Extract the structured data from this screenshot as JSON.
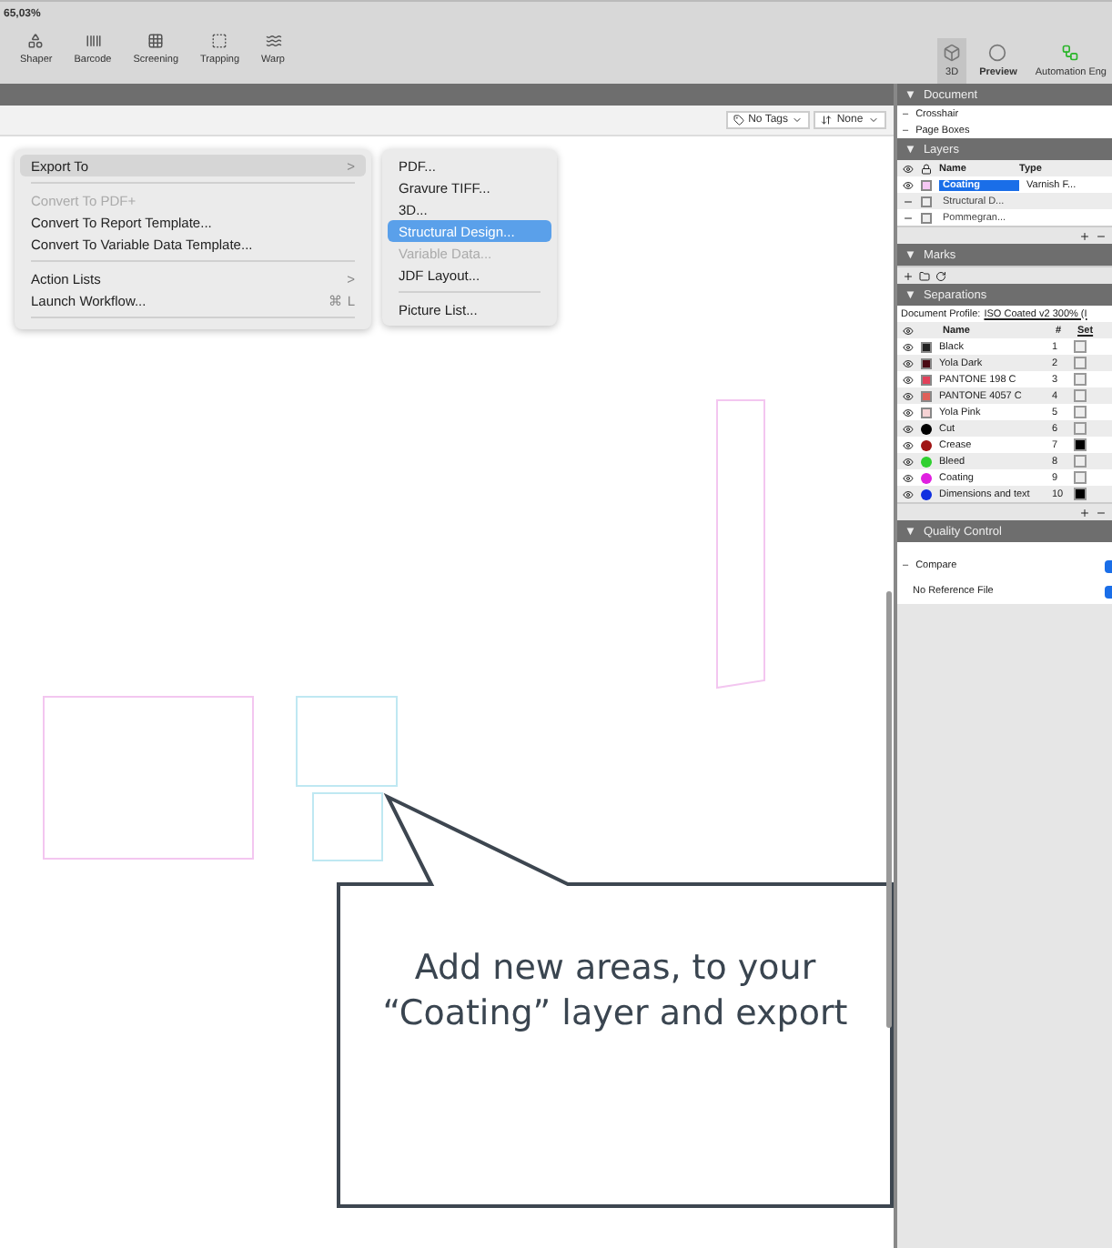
{
  "zoom": "65,03%",
  "tools": [
    {
      "label": "Shaper",
      "kind": "shaper"
    },
    {
      "label": "Barcode",
      "kind": "barcode"
    },
    {
      "label": "Screening",
      "kind": "screening"
    },
    {
      "label": "Trapping",
      "kind": "trapping"
    },
    {
      "label": "Warp",
      "kind": "warp"
    }
  ],
  "view_tools": [
    {
      "label": "3D",
      "kind": "cube",
      "selected": true
    },
    {
      "label": "Preview",
      "kind": "preview",
      "selected": false
    },
    {
      "label": "Automation Eng",
      "kind": "automation",
      "selected": false
    }
  ],
  "filters": [
    {
      "label": "No Tags",
      "kind": "tag"
    },
    {
      "label": "None",
      "kind": "sort"
    }
  ],
  "menu": {
    "items": [
      {
        "kind": "item",
        "label": "Export To",
        "arrow": ">",
        "selected": true,
        "disabled": false
      },
      {
        "kind": "separator"
      },
      {
        "kind": "item",
        "label": "Convert To PDF+",
        "selected": false,
        "disabled": true
      },
      {
        "kind": "item",
        "label": "Convert To Report Template...",
        "selected": false,
        "disabled": false
      },
      {
        "kind": "item",
        "label": "Convert To Variable Data Template...",
        "selected": false,
        "disabled": false
      },
      {
        "kind": "separator"
      },
      {
        "kind": "item",
        "label": "Action Lists",
        "arrow": ">",
        "selected": false,
        "disabled": false
      },
      {
        "kind": "item",
        "label": "Launch Workflow...",
        "shortcut": "⌘ L",
        "selected": false,
        "disabled": false
      },
      {
        "kind": "separator"
      }
    ]
  },
  "submenu": {
    "items": [
      {
        "kind": "item",
        "label": "PDF...",
        "selected": false,
        "disabled": false
      },
      {
        "kind": "item",
        "label": "Gravure TIFF...",
        "selected": false,
        "disabled": false
      },
      {
        "kind": "item",
        "label": "3D...",
        "selected": false,
        "disabled": false
      },
      {
        "kind": "item",
        "label": "Structural Design...",
        "selected": true,
        "disabled": false
      },
      {
        "kind": "item",
        "label": "Variable Data...",
        "selected": false,
        "disabled": true
      },
      {
        "kind": "item",
        "label": "JDF Layout...",
        "selected": false,
        "disabled": false
      },
      {
        "kind": "separator"
      },
      {
        "kind": "item",
        "label": "Picture List...",
        "selected": false,
        "disabled": false
      }
    ]
  },
  "document": {
    "marker": "▼",
    "title": "Document",
    "items": [
      {
        "marker": "–",
        "label": "Crosshair"
      },
      {
        "marker": "–",
        "label": "Page Boxes"
      }
    ]
  },
  "layers": {
    "marker": "▼",
    "title": "Layers",
    "columns": [
      "Name",
      "Type"
    ],
    "rows": [
      {
        "visible": true,
        "name": "Coating",
        "type": "Varnish F...",
        "selected": true
      },
      {
        "visible": false,
        "name": "Structural D...",
        "selected": false
      },
      {
        "visible": false,
        "name": "Pommegran...",
        "selected": false
      }
    ]
  },
  "marks": {
    "marker": "▼",
    "title": "Marks"
  },
  "separations": {
    "marker": "▼",
    "title": "Separations",
    "profile_label": "Document Profile:",
    "profile": "ISO Coated v2 300% (I",
    "columns": [
      "Name",
      "#",
      "Set"
    ],
    "rows": [
      {
        "name": "Black",
        "number": "1",
        "color": "#222222",
        "kind": "ink",
        "set": false
      },
      {
        "name": "Yola Dark",
        "number": "2",
        "color": "#4a0a14",
        "kind": "ink",
        "set": false
      },
      {
        "name": "PANTONE 198 C",
        "number": "3",
        "color": "#e2405a",
        "kind": "ink",
        "set": false
      },
      {
        "name": "PANTONE 4057 C",
        "number": "4",
        "color": "#e0605a",
        "kind": "ink",
        "set": false
      },
      {
        "name": "Yola Pink",
        "number": "5",
        "color": "#f6d2d4",
        "kind": "ink",
        "set": false
      },
      {
        "name": "Cut",
        "number": "6",
        "color": "#000000",
        "kind": "mark",
        "set": false
      },
      {
        "name": "Crease",
        "number": "7",
        "color": "#a01414",
        "kind": "mark",
        "set": true
      },
      {
        "name": "Bleed",
        "number": "8",
        "color": "#30d030",
        "kind": "mark",
        "set": false
      },
      {
        "name": "Coating",
        "number": "9",
        "color": "#e020e0",
        "kind": "mark",
        "set": false
      },
      {
        "name": "Dimensions and text",
        "number": "10",
        "color": "#1030e0",
        "kind": "mark",
        "set": true
      }
    ]
  },
  "quality_control": {
    "marker": "▼",
    "title": "Quality Control",
    "items": [
      {
        "marker": "–",
        "label": "Compare"
      },
      {
        "label": "No Reference File"
      }
    ]
  },
  "callout": {
    "text": "Add new areas, to your “Coating” layer and export"
  }
}
